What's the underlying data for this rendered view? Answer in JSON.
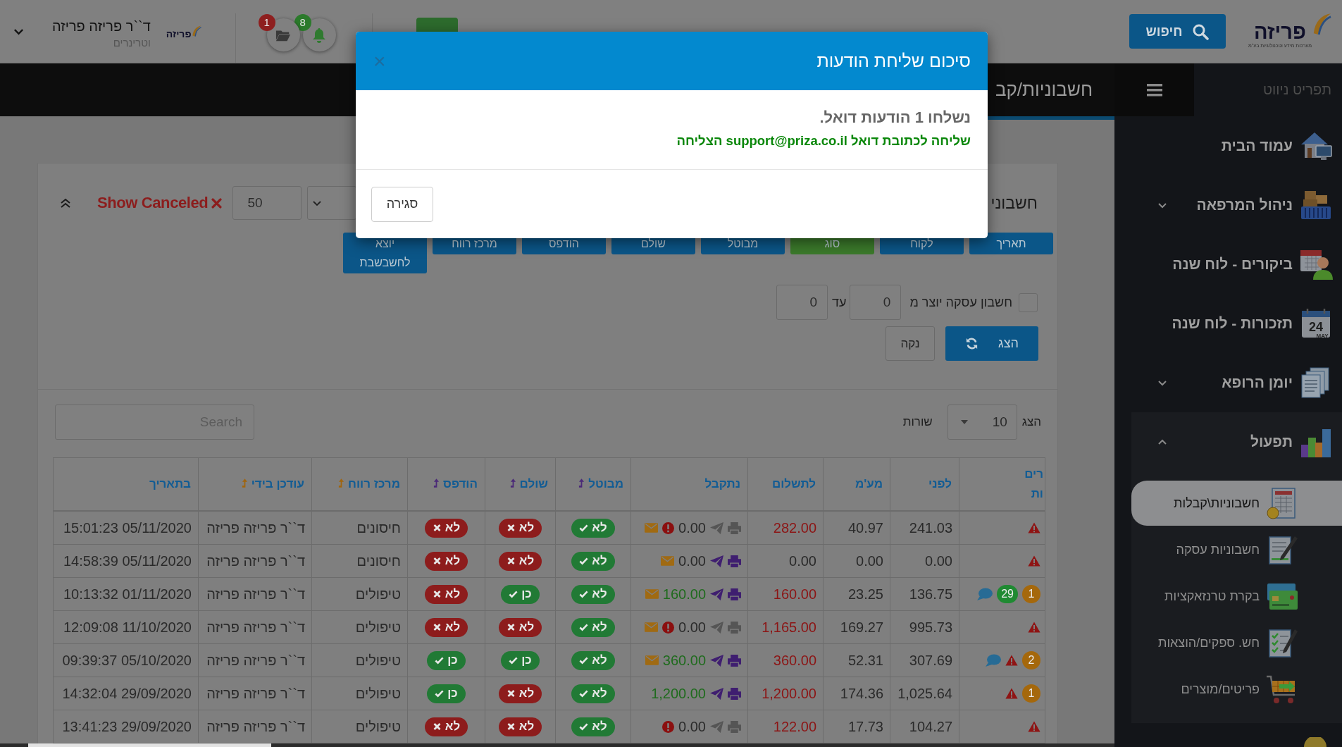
{
  "header": {
    "logo": {
      "name": "פריזה",
      "tagline": "מערכות מידע וטכנולוגיות בע\"מ"
    },
    "search_button": "חיפוש",
    "notifications": [
      {
        "kind": "bell",
        "count": "8",
        "color": "#2b7a2b"
      },
      {
        "kind": "folder",
        "count": "1",
        "color": "#8e1f1f"
      }
    ],
    "user": {
      "logo": "פריזה",
      "name": "ד``ר פריזה פריזה",
      "role": "וטרינרים"
    }
  },
  "sidebar": {
    "heading": "תפריט ניווט",
    "items": [
      {
        "kind": "link",
        "label": "עמוד הבית"
      },
      {
        "kind": "group",
        "label": "ניהול המרפאה",
        "expanded": false
      },
      {
        "kind": "link",
        "label": "ביקורים - לוח שנה"
      },
      {
        "kind": "link",
        "label": "תזכורות - לוח שנה",
        "icon_text": "24",
        "icon_caption": "MAY"
      },
      {
        "kind": "group",
        "label": "יומן הרופא",
        "expanded": false
      },
      {
        "kind": "group",
        "label": "תפעול",
        "expanded": true,
        "children": [
          {
            "label": "חשבוניות\\קבלות",
            "selected": true
          },
          {
            "label": "חשבוניות עסקה",
            "selected": false
          },
          {
            "label": "בקרת טרנזאקציות",
            "selected": false
          },
          {
            "label": "חש. ספקים/הוצאות",
            "selected": false
          },
          {
            "label": "פריטים/מוצרים",
            "selected": false
          }
        ]
      }
    ]
  },
  "page_title": "חשבוניות/קב",
  "filters": {
    "title": "חשבוני",
    "show_canceled": "Show Canceled",
    "page_size": "50",
    "column_buttons": [
      {
        "label": "תאריך",
        "selected": false
      },
      {
        "label": "לקוח",
        "selected": false
      },
      {
        "label": "סוג",
        "selected": true
      },
      {
        "label": "מבוטל",
        "selected": false
      },
      {
        "label": "שולם",
        "selected": false
      },
      {
        "label": "הודפס",
        "selected": false
      },
      {
        "label": "מרכז רווח",
        "selected": false
      },
      {
        "label": "יוצא לחשבשבת",
        "selected": false
      }
    ],
    "range": {
      "checked": false,
      "label": "חשבון עסקה יוצר מ",
      "from": "0",
      "to_label": "עד",
      "to": "0"
    },
    "show_button": "הצג",
    "clear_button": "נקה"
  },
  "table_controls": {
    "show_label": "הצג",
    "rows_value": "10",
    "rows_label": "שורות",
    "search_placeholder": "Search"
  },
  "table": {
    "columns": [
      {
        "label": "רים\nות"
      },
      {
        "label": "לפני"
      },
      {
        "label": "מע'מ"
      },
      {
        "label": "לתשלום"
      },
      {
        "label": "נתקבל"
      },
      {
        "label": "מבוטל",
        "sort_icon": {
          "color": "#4b2a78"
        }
      },
      {
        "label": "שולם",
        "sort_icon": {
          "color": "#4b2a78"
        }
      },
      {
        "label": "הודפס",
        "sort_icon": {
          "color": "#4b2a78"
        }
      },
      {
        "label": "מרכז רווח",
        "sort_icon": {
          "color": "#a0650f"
        }
      },
      {
        "label": "עודכן בידי",
        "sort_icon": {
          "color": "#a0650f"
        }
      },
      {
        "label": "בתאריך"
      }
    ],
    "rows": [
      {
        "marks": [
          {
            "kind": "alert"
          }
        ],
        "before": "241.03",
        "vat": "40.97",
        "total": "282.00",
        "total_due": true,
        "received": {
          "amount": "0.00",
          "collected": false,
          "docs_active": false,
          "warning": true,
          "email": true
        },
        "canceled": {
          "text": "לא",
          "ok": true
        },
        "settled": {
          "text": "לא",
          "ok": false
        },
        "printed": {
          "text": "לא",
          "ok": false
        },
        "profit_center": "חיסונים",
        "updated_by": "ד``ר פריזה פריזה",
        "date": "15:01:23 05/11/2020"
      },
      {
        "marks": [
          {
            "kind": "alert"
          }
        ],
        "before": "0.00",
        "vat": "0.00",
        "total": "0.00",
        "total_due": false,
        "received": {
          "amount": "0.00",
          "collected": false,
          "docs_active": true,
          "warning": false,
          "email": true
        },
        "canceled": {
          "text": "לא",
          "ok": true
        },
        "settled": {
          "text": "לא",
          "ok": false
        },
        "printed": {
          "text": "לא",
          "ok": false
        },
        "profit_center": "חיסונים",
        "updated_by": "ד``ר פריזה פריזה",
        "date": "14:58:39 05/11/2020"
      },
      {
        "marks": [
          {
            "kind": "badge",
            "text": "1",
            "color": "#a5680c"
          },
          {
            "kind": "badge",
            "text": "29",
            "color": "#1f8a32"
          },
          {
            "kind": "comment"
          }
        ],
        "before": "136.75",
        "vat": "23.25",
        "total": "160.00",
        "total_due": true,
        "received": {
          "amount": "160.00",
          "collected": true,
          "docs_active": true,
          "warning": false,
          "email": true
        },
        "canceled": {
          "text": "לא",
          "ok": true
        },
        "settled": {
          "text": "כן",
          "ok": true
        },
        "printed": {
          "text": "לא",
          "ok": false
        },
        "profit_center": "טיפולים",
        "updated_by": "ד``ר פריזה פריזה",
        "date": "10:13:32 01/11/2020"
      },
      {
        "marks": [
          {
            "kind": "alert"
          }
        ],
        "before": "995.73",
        "vat": "169.27",
        "total": "1,165.00",
        "total_due": true,
        "received": {
          "amount": "0.00",
          "collected": false,
          "docs_active": false,
          "warning": true,
          "email": true
        },
        "canceled": {
          "text": "לא",
          "ok": true
        },
        "settled": {
          "text": "לא",
          "ok": false
        },
        "printed": {
          "text": "לא",
          "ok": false
        },
        "profit_center": "טיפולים",
        "updated_by": "ד``ר פריזה פריזה",
        "date": "12:09:08 11/10/2020"
      },
      {
        "marks": [
          {
            "kind": "badge",
            "text": "2",
            "color": "#a5680c"
          },
          {
            "kind": "alert"
          },
          {
            "kind": "comment"
          }
        ],
        "before": "307.69",
        "vat": "52.31",
        "total": "360.00",
        "total_due": true,
        "received": {
          "amount": "360.00",
          "collected": true,
          "docs_active": true,
          "warning": false,
          "email": true
        },
        "canceled": {
          "text": "לא",
          "ok": true
        },
        "settled": {
          "text": "כן",
          "ok": true
        },
        "printed": {
          "text": "כן",
          "ok": true
        },
        "profit_center": "טיפולים",
        "updated_by": "ד``ר פריזה פריזה",
        "date": "09:39:37 05/10/2020"
      },
      {
        "marks": [
          {
            "kind": "badge",
            "text": "1",
            "color": "#a5680c"
          },
          {
            "kind": "alert"
          }
        ],
        "before": "1,025.64",
        "vat": "174.36",
        "total": "1,200.00",
        "total_due": true,
        "received": {
          "amount": "1,200.00",
          "collected": true,
          "docs_active": true,
          "warning": false,
          "email": false
        },
        "canceled": {
          "text": "לא",
          "ok": true
        },
        "settled": {
          "text": "לא",
          "ok": false
        },
        "printed": {
          "text": "כן",
          "ok": true
        },
        "profit_center": "טיפולים",
        "updated_by": "ד``ר פריזה פריזה",
        "date": "14:32:04 29/09/2020"
      },
      {
        "marks": [
          {
            "kind": "alert"
          }
        ],
        "before": "104.27",
        "vat": "17.73",
        "total": "122.00",
        "total_due": true,
        "received": {
          "amount": "0.00",
          "collected": false,
          "docs_active": false,
          "warning": true,
          "email": false
        },
        "canceled": {
          "text": "לא",
          "ok": true
        },
        "settled": {
          "text": "לא",
          "ok": false
        },
        "printed": {
          "text": "לא",
          "ok": false
        },
        "profit_center": "טיפולים",
        "updated_by": "ד``ר פריזה פריזה",
        "date": "13:41:23 29/09/2020"
      }
    ]
  },
  "modal": {
    "title": "סיכום שליחת הודעות",
    "close": "×",
    "summary": "נשלחו 1 הודעות דואל.",
    "message": "שליחה לכתובת דואל support@priza.co.il הצליחה",
    "button": "סגירה"
  }
}
